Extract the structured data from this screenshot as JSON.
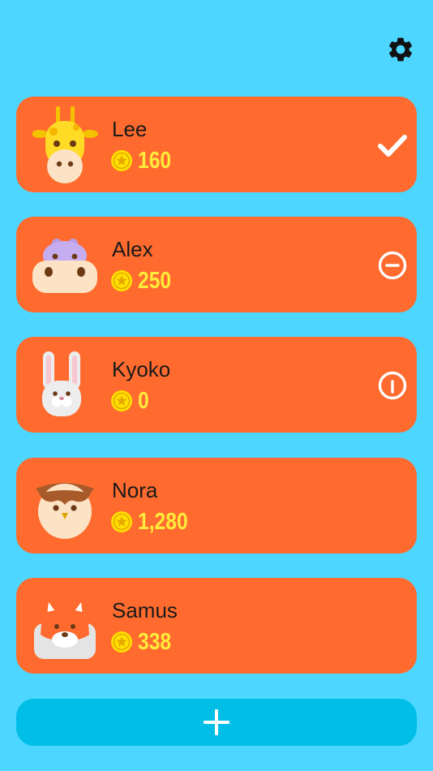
{
  "colors": {
    "background": "#4DD6FF",
    "card": "#FF6B2E",
    "coin_text": "#FFEB3B",
    "add_button": "#00BEE6"
  },
  "settings": {
    "icon": "gear-icon"
  },
  "players": [
    {
      "name": "Lee",
      "coins": "160",
      "animal": "giraffe",
      "status": "selected-check"
    },
    {
      "name": "Alex",
      "coins": "250",
      "animal": "hippo",
      "status": "minus-circle"
    },
    {
      "name": "Kyoko",
      "coins": "0",
      "animal": "rabbit",
      "status": "power-circle"
    },
    {
      "name": "Nora",
      "coins": "1,280",
      "animal": "owl",
      "status": "none"
    },
    {
      "name": "Samus",
      "coins": "338",
      "animal": "fox",
      "status": "none"
    }
  ],
  "add_button": {
    "icon": "plus-icon"
  }
}
